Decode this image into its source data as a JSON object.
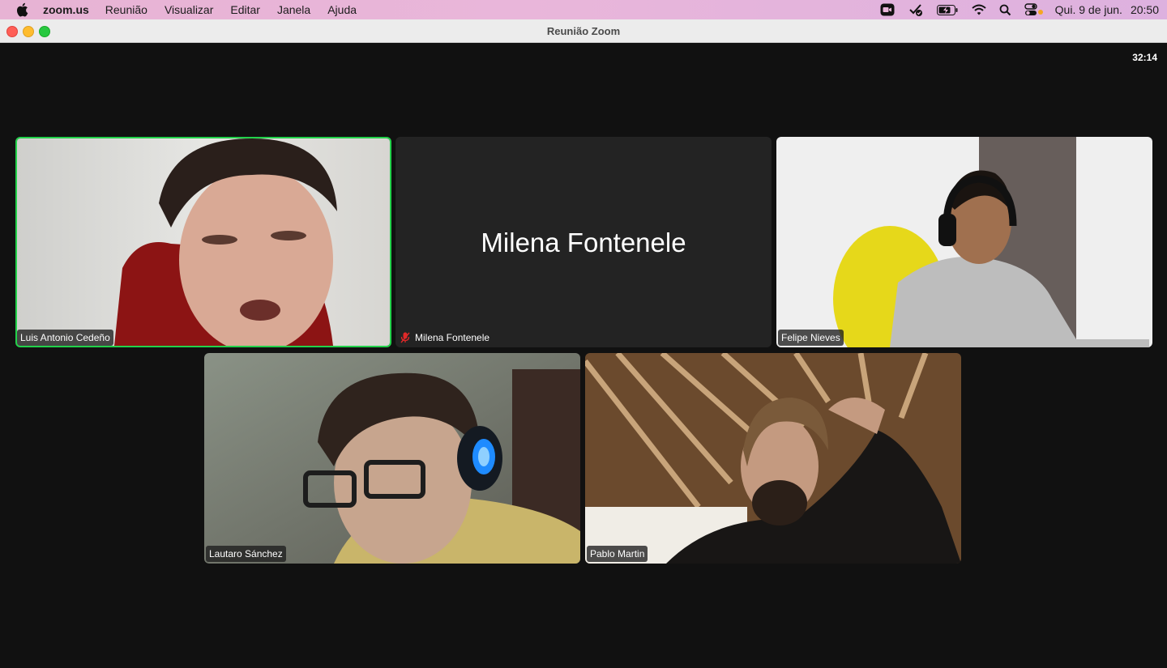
{
  "menubar": {
    "app_name": "zoom.us",
    "items": [
      "Reunião",
      "Visualizar",
      "Editar",
      "Janela",
      "Ajuda"
    ],
    "date": "Qui. 9 de jun.",
    "time": "20:50",
    "status_icons": [
      "zoom-video-icon",
      "checkmark-icon",
      "battery-icon",
      "wifi-icon",
      "search-icon",
      "control-center-icon"
    ]
  },
  "window": {
    "title": "Reunião Zoom"
  },
  "meeting": {
    "elapsed": "32:14",
    "active_speaker_color": "#22d14a",
    "participants": [
      {
        "name": "Luis Antonio Cedeño",
        "video": true,
        "speaking": true
      },
      {
        "name": "Milena Fontenele",
        "video": false,
        "muted": true,
        "display_name": "Milena Fontenele"
      },
      {
        "name": "Felipe Nieves",
        "video": true
      },
      {
        "name": "Lautaro Sánchez",
        "video": true
      },
      {
        "name": "Pablo Martin",
        "video": true
      }
    ]
  }
}
